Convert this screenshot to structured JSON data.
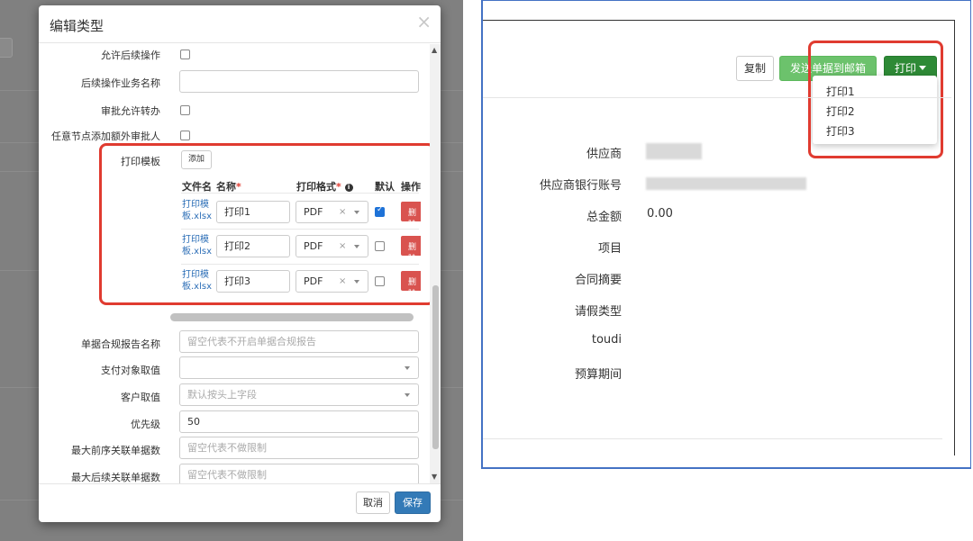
{
  "left": {
    "modal": {
      "title": "编辑类型",
      "close_glyph": "×",
      "fields": {
        "allow_followup": "允许后续操作",
        "followup_name": "后续操作业务名称",
        "approval_transfer": "审批允许转办",
        "add_approvers": "任意节点添加额外审批人",
        "print_template": "打印模板"
      },
      "add_button": "添加",
      "table_headers": {
        "file": "文件名",
        "name": "名称",
        "name_req": "*",
        "format": "打印格式",
        "format_req": "*",
        "format_info": "i",
        "default": "默认",
        "action": "操作"
      },
      "print_rows": [
        {
          "file": "打印模板.xlsx",
          "name": "打印1",
          "format": "PDF",
          "clear": "×",
          "default_checked": true,
          "delete": "删除"
        },
        {
          "file": "打印模板.xlsx",
          "name": "打印2",
          "format": "PDF",
          "clear": "×",
          "default_checked": false,
          "delete": "删除"
        },
        {
          "file": "打印模板.xlsx",
          "name": "打印3",
          "format": "PDF",
          "clear": "×",
          "default_checked": false,
          "delete": "删除"
        }
      ],
      "lower_fields": [
        {
          "label": "单据合规报告名称",
          "value": "",
          "placeholder": "留空代表不开启单据合规报告",
          "type": "input"
        },
        {
          "label": "支付对象取值",
          "value": "",
          "placeholder": "",
          "type": "select"
        },
        {
          "label": "客户取值",
          "value": "",
          "placeholder": "默认按头上字段",
          "type": "select"
        },
        {
          "label": "优先级",
          "value": "50",
          "placeholder": "",
          "type": "input"
        },
        {
          "label": "最大前序关联单据数",
          "value": "",
          "placeholder": "留空代表不做限制",
          "type": "input"
        },
        {
          "label": "最大后续关联单据数",
          "value": "",
          "placeholder": "留空代表不做限制",
          "type": "input"
        }
      ],
      "cancel_button": "取消",
      "save_button": "保存"
    }
  },
  "right": {
    "buttons": {
      "copy": "复制",
      "send_email": "发送单据到邮箱",
      "print": "打印"
    },
    "print_menu": [
      "打印1",
      "打印2",
      "打印3"
    ],
    "detail_rows": [
      {
        "label": "供应商",
        "value": ""
      },
      {
        "label": "供应商银行账号",
        "value": ""
      },
      {
        "label": "总金额",
        "value": "0.00"
      },
      {
        "label": "项目",
        "value": ""
      },
      {
        "label": "合同摘要",
        "value": ""
      },
      {
        "label": "请假类型",
        "value": ""
      },
      {
        "label": "toudi",
        "value": ""
      },
      {
        "label": "预算期间",
        "value": ""
      }
    ]
  },
  "colors": {
    "highlight_red": "#e03b30",
    "primary_blue": "#337ab7",
    "link_blue": "#2d6fb7",
    "danger_red": "#d9534f",
    "green": "#6cc26c",
    "dark_green": "#2e8a36",
    "frame_blue": "#4472c4"
  }
}
